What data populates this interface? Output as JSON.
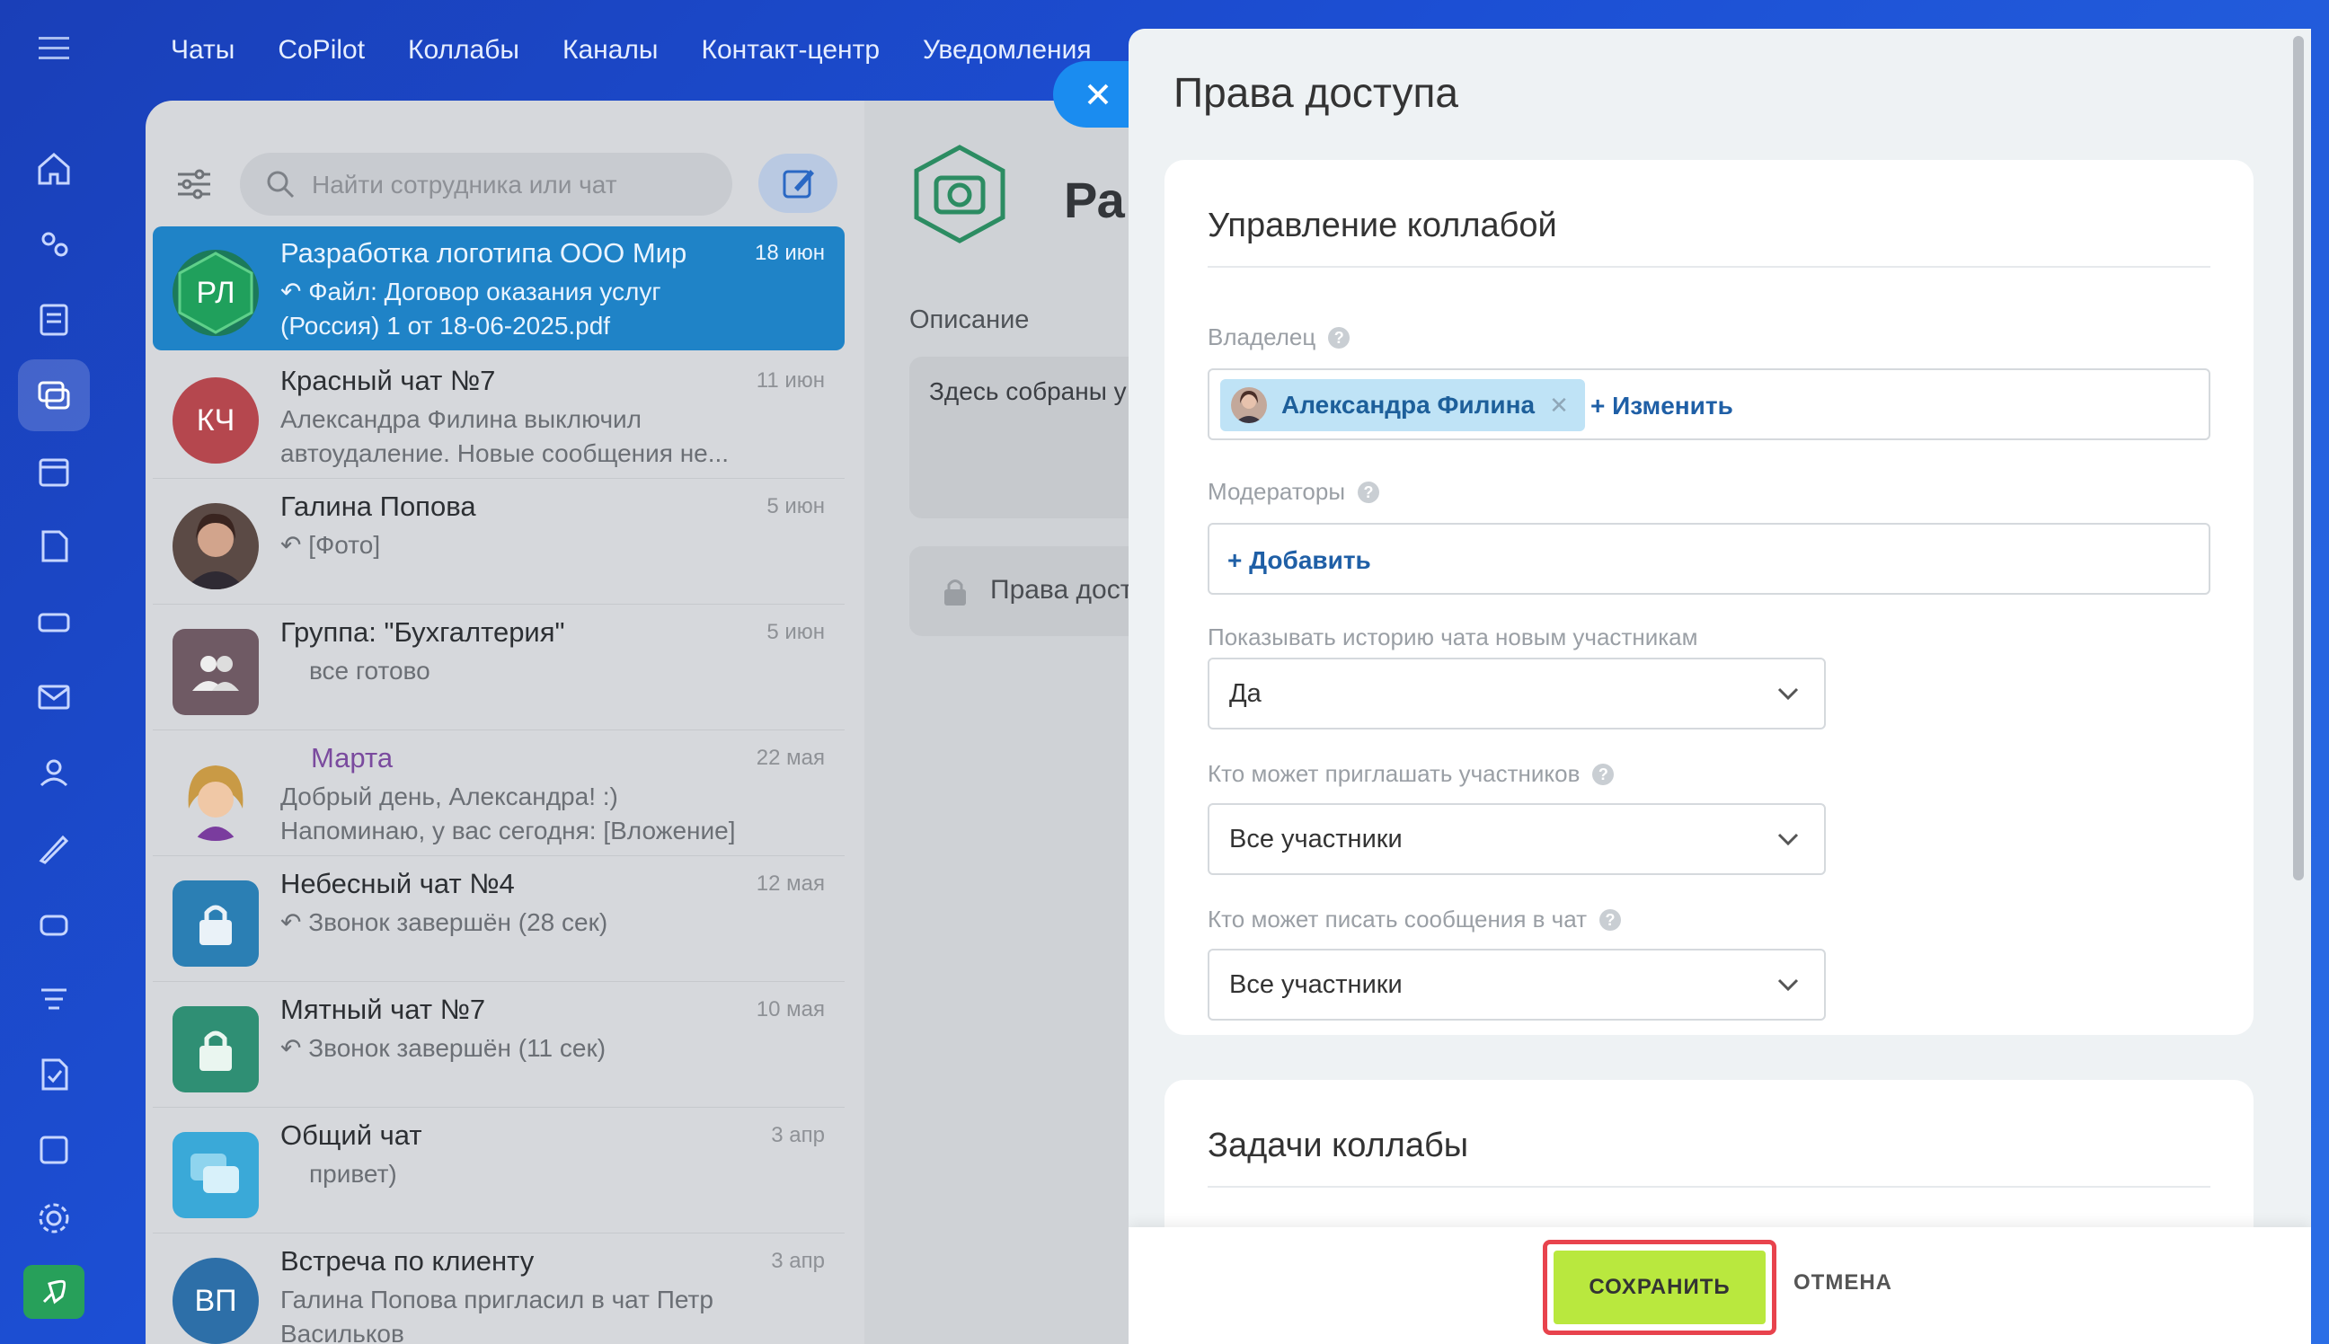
{
  "topnav": {
    "items": [
      "Чаты",
      "CoPilot",
      "Коллабы",
      "Каналы",
      "Контакт-центр",
      "Уведомления"
    ]
  },
  "rail": {
    "icons": [
      "menu-icon",
      "home-icon",
      "collab-icon",
      "feed-icon",
      "chat-icon",
      "calendar-icon",
      "docs-icon",
      "drive-icon",
      "mail-icon",
      "users-icon",
      "sign-icon",
      "robot-icon",
      "funnel-icon",
      "tasks-icon",
      "check-icon",
      "settings-icon",
      "rocket-icon"
    ]
  },
  "chatlist": {
    "search_placeholder": "Найти сотрудника или чат",
    "items": [
      {
        "name": "Разработка логотипа ООО Мир",
        "preview": "↶ Файл: Договор оказания услуг (Россия) 1 от 18-06-2025.pdf",
        "date": "18 июн",
        "initials": "РЛ"
      },
      {
        "name": "Красный чат №7",
        "preview": "Александра Филина выключил автоудаление. Новые сообщения не...",
        "date": "11 июн",
        "initials": "КЧ"
      },
      {
        "name": "Галина Попова",
        "preview": "↶ [Фото]",
        "date": "5 июн",
        "initials": ""
      },
      {
        "name": "Группа: \"Бухгалтерия\"",
        "preview": "все готово",
        "date": "5 июн",
        "initials": ""
      },
      {
        "name": "Марта",
        "preview": "Добрый день, Александра! :) Напоминаю, у вас сегодня: [Вложение]",
        "date": "22 мая",
        "initials": ""
      },
      {
        "name": "Небесный чат №4",
        "preview": "↶ Звонок завершён (28 сек)",
        "date": "12 мая",
        "initials": ""
      },
      {
        "name": "Мятный чат №7",
        "preview": "↶ Звонок завершён (11 сек)",
        "date": "10 мая",
        "initials": ""
      },
      {
        "name": "Общий чат",
        "preview": "привет)",
        "date": "3 апр",
        "initials": ""
      },
      {
        "name": "Встреча по клиенту",
        "preview": "Галина Попова пригласил в чат Петр Васильков",
        "date": "3 апр",
        "initials": "ВП"
      }
    ]
  },
  "middle": {
    "title": "Ра",
    "desc_label": "Описание",
    "desc_text": "Здесь собраны у Мир",
    "rights_label": "Права дост"
  },
  "slider": {
    "title": "Права доступа",
    "section1": {
      "title": "Управление коллабой",
      "owner_label": "Владелец",
      "owner_name": "Александра Филина",
      "change_link": "+ Изменить",
      "moderators_label": "Модераторы",
      "add_link": "+ Добавить",
      "history_label": "Показывать историю чата новым участникам",
      "history_value": "Да",
      "invite_label": "Кто может приглашать участников",
      "invite_value": "Все участники",
      "write_label": "Кто может писать сообщения в чат",
      "write_value": "Все участники"
    },
    "section2": {
      "title": "Задачи коллабы"
    },
    "save_label": "СОХРАНИТЬ",
    "cancel_label": "ОТМЕНА"
  },
  "colors": {
    "accent": "#1a8cf0",
    "save": "#b9e83e",
    "highlight": "#e8434d",
    "active_chat": "#1f83c7"
  }
}
